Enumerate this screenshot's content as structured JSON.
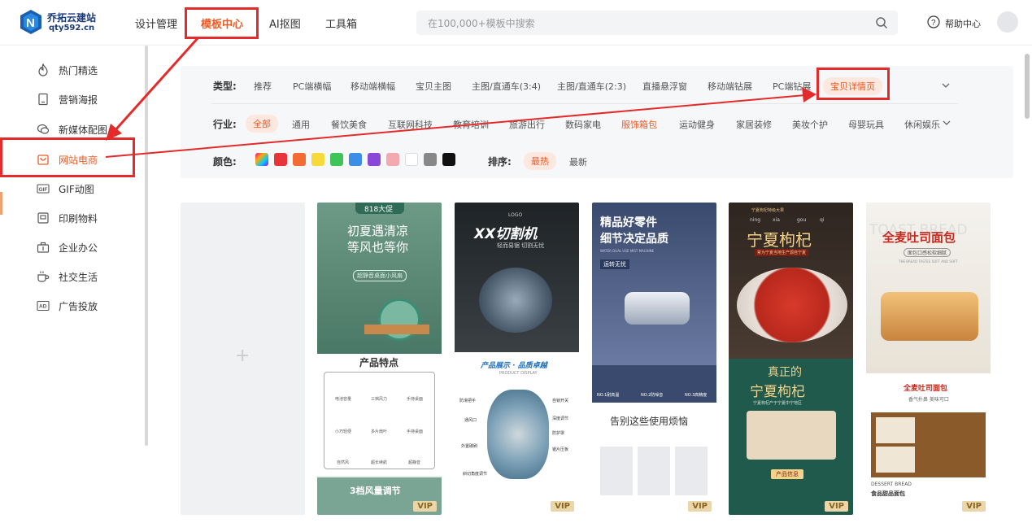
{
  "brand": {
    "name": "乔拓云建站",
    "url": "qty592.cn"
  },
  "nav": [
    {
      "label": "设计管理"
    },
    {
      "label": "模板中心",
      "active": true
    },
    {
      "label": "AI抠图"
    },
    {
      "label": "工具箱"
    }
  ],
  "search": {
    "placeholder": "在100,000+模板中搜索"
  },
  "help": {
    "label": "帮助中心"
  },
  "sidebar": {
    "items": [
      {
        "label": "热门精选",
        "icon": "flame-icon"
      },
      {
        "label": "营销海报",
        "icon": "poster-icon"
      },
      {
        "label": "新媒体配图",
        "icon": "chat-icon"
      },
      {
        "label": "网站电商",
        "icon": "shop-icon",
        "active": true
      },
      {
        "label": "GIF动图",
        "icon": "gif-icon"
      },
      {
        "label": "印刷物料",
        "icon": "print-icon"
      },
      {
        "label": "企业办公",
        "icon": "briefcase-icon"
      },
      {
        "label": "社交生活",
        "icon": "cup-icon"
      },
      {
        "label": "广告投放",
        "icon": "ad-icon"
      }
    ]
  },
  "filters": {
    "type_label": "类型:",
    "types": [
      "推荐",
      "PC端横幅",
      "移动端横幅",
      "宝贝主图",
      "主图/直通车(3:4)",
      "主图/直通车(2:3)",
      "直播悬浮窗",
      "移动端钻展",
      "PC端钻展",
      "宝贝详情页"
    ],
    "type_selected": "宝贝详情页",
    "industry_label": "行业:",
    "industries": [
      "全部",
      "通用",
      "餐饮美食",
      "互联网科技",
      "教育培训",
      "旅游出行",
      "数码家电",
      "服饰箱包",
      "运动健身",
      "家居装修",
      "美妆个护",
      "母婴玩具",
      "休闲娱乐"
    ],
    "industry_selected": "全部",
    "industry_highlight": "服饰箱包",
    "color_label": "颜色:",
    "colors": [
      "rainbow",
      "#e8343a",
      "#f26b32",
      "#f7d93a",
      "#3fc45a",
      "#3a8ee8",
      "#8a48d8",
      "#f4a8b0",
      "#ffffff",
      "#888888",
      "#111111"
    ],
    "sort_label": "排序:",
    "sorts": [
      "最热",
      "最新"
    ],
    "sort_selected": "最热"
  },
  "cards": [
    {
      "tag": "818大促",
      "title_line1": "初夏遇清凉",
      "title_line2": "等风也等你",
      "sub": "超静音桌面小风扇",
      "features_title": "产品特点",
      "features": [
        "电池容量",
        "三档风力",
        "手持桌面",
        "小巧轻便",
        "多片扇叶",
        "手持桌面",
        "自然风",
        "超长续航",
        "超静音"
      ],
      "footer": "3档风量调节",
      "vip": "VIP"
    },
    {
      "logo": "LOGO",
      "title": "XX切割机",
      "sub": "轻而易锯 切割无忧",
      "section": "产品展示 · 品质卓越",
      "section_sub": "PRODUCT DISPLAY",
      "labels": [
        "防滑把手",
        "通风口",
        "外置碳刷",
        "自锁开关",
        "深度调节",
        "防护罩",
        "锯片压板",
        "斜切角度调节"
      ],
      "vip": "VIP"
    },
    {
      "title_line1": "精品好零件",
      "title_line2": "细节决定品质",
      "sub": "WATER DUAL USE MIST MACHINE",
      "badge": "运转无忧",
      "icons": [
        "NO.1耐高温",
        "NO.2防噪音",
        "NO.3高精度"
      ],
      "section": "告别这些使用烦恼",
      "vip": "VIP"
    },
    {
      "top": "宁夏枸杞特级大果",
      "pinyin": [
        "ning",
        "xia",
        "gou",
        "qi"
      ],
      "title": "宁夏枸杞",
      "ribbon": "累为宁夏当地生产源自宁夏",
      "title2_line1": "真正的",
      "title2_line2": "宁夏枸杞",
      "desc": "宁夏枸杞产于宁夏中宁地区",
      "badge": "产品信息",
      "vip": "VIP"
    },
    {
      "bg_text": "TOAST BREAD",
      "title": "全麦吐司面包",
      "sub": "面包口感松软细腻",
      "tiny": "THE BREAD TASTES SOFT AND SOFT",
      "section": "全麦吐司面包",
      "section_sub": "香气扑鼻 美味可口",
      "footer_en": "DESSERT BREAD",
      "footer_cn": "食品甜品面包",
      "vip": "VIP"
    }
  ]
}
